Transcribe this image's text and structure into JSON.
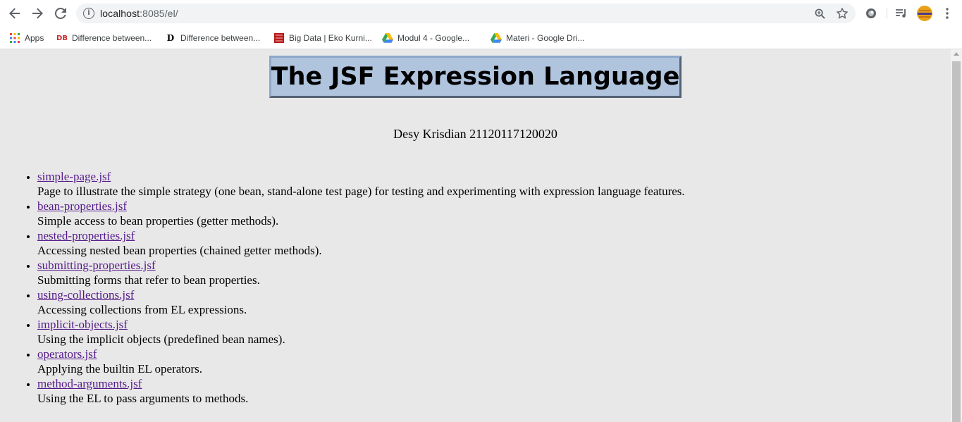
{
  "browser": {
    "url_host": "localhost",
    "url_rest": ":8085/el/",
    "icons": {
      "back": "back-arrow-icon",
      "forward": "forward-arrow-icon",
      "reload": "reload-icon",
      "info": "info-icon",
      "zoom": "zoom-icon",
      "bookmark": "star-icon",
      "extension": "extension-icon",
      "media": "media-control-icon",
      "profile": "profile-avatar",
      "menu": "kebab-menu-icon"
    }
  },
  "bookmarks": [
    {
      "label": "Apps",
      "icon": "apps-grid-icon"
    },
    {
      "label": "Difference between...",
      "icon": "db-favicon",
      "fav_text": "DB"
    },
    {
      "label": "Difference between...",
      "icon": "d-favicon",
      "fav_text": "D"
    },
    {
      "label": "Big Data | Eko Kurni...",
      "icon": "book-favicon"
    },
    {
      "label": "Modul 4 - Google...",
      "icon": "google-drive-icon"
    },
    {
      "label": "Materi - Google Dri...",
      "icon": "google-drive-icon"
    }
  ],
  "page": {
    "title": "The JSF Expression Language",
    "author": "Desy Krisdian 21120117120020",
    "items": [
      {
        "link": "simple-page.jsf",
        "desc": "Page to illustrate the simple strategy (one bean, stand-alone test page) for testing and experimenting with expression language features."
      },
      {
        "link": "bean-properties.jsf",
        "desc": "Simple access to bean properties (getter methods)."
      },
      {
        "link": "nested-properties.jsf",
        "desc": "Accessing nested bean properties (chained getter methods)."
      },
      {
        "link": "submitting-properties.jsf",
        "desc": "Submitting forms that refer to bean properties."
      },
      {
        "link": "using-collections.jsf",
        "desc": "Accessing collections from EL expressions."
      },
      {
        "link": "implicit-objects.jsf",
        "desc": "Using the implicit objects (predefined bean names)."
      },
      {
        "link": "operators.jsf",
        "desc": "Applying the builtin EL operators."
      },
      {
        "link": "method-arguments.jsf",
        "desc": "Using the EL to pass arguments to methods."
      }
    ]
  },
  "colors": {
    "page_bg": "#e8e8e8",
    "title_bg": "#b0c4de",
    "link_visited": "#551a8b"
  }
}
